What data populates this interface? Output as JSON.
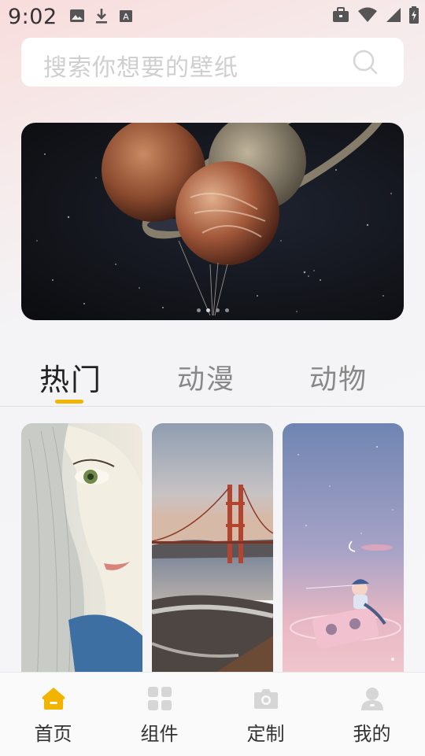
{
  "status_bar": {
    "time": "9:02",
    "left_icons": [
      "image-icon",
      "download-icon",
      "text-a-icon"
    ],
    "right_icons": [
      "briefcase-icon",
      "wifi-icon",
      "signal-icon",
      "battery-charging-icon"
    ]
  },
  "search": {
    "placeholder": "搜索你想要的壁纸",
    "icon": "search-icon"
  },
  "banner": {
    "image": "planet-balloons-space",
    "dots": 4,
    "active_dot": 0
  },
  "tabs": [
    {
      "label": "热门",
      "active": true
    },
    {
      "label": "动漫",
      "active": false
    },
    {
      "label": "动物",
      "active": false
    }
  ],
  "accent_color": "#f3b400",
  "wallpapers": [
    {
      "image": "anime-girl-green-eye"
    },
    {
      "image": "golden-gate-bridge-beach"
    },
    {
      "image": "dreamy-pink-sky-cassette"
    }
  ],
  "bottom_nav": [
    {
      "label": "首页",
      "icon": "home-icon",
      "active": true
    },
    {
      "label": "组件",
      "icon": "widgets-grid-icon",
      "active": false
    },
    {
      "label": "定制",
      "icon": "camera-icon",
      "active": false
    },
    {
      "label": "我的",
      "icon": "profile-icon",
      "active": false
    }
  ]
}
